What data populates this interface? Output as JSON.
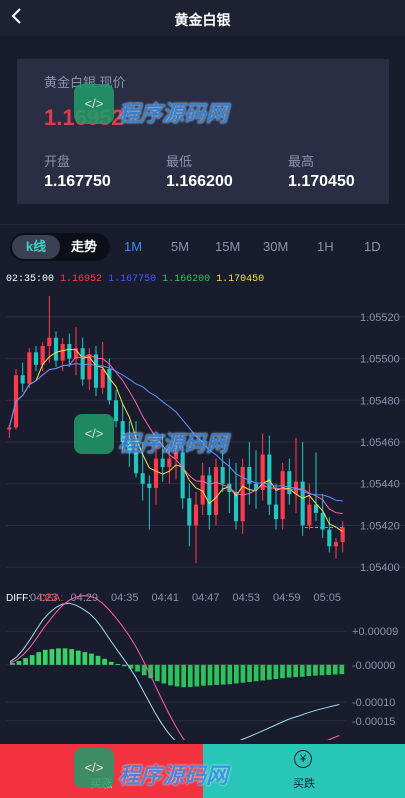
{
  "header": {
    "title": "黄金白银",
    "back_icon": "chevron-left-icon"
  },
  "card": {
    "label": "黄金白银 现价",
    "price": "1.16952",
    "open_label": "开盘",
    "open_value": "1.167750",
    "low_label": "最低",
    "low_value": "1.166200",
    "high_label": "最高",
    "high_value": "1.170450"
  },
  "tabs": {
    "kline": "k线",
    "trend": "走势",
    "timeframes": [
      "1M",
      "5M",
      "15M",
      "30M",
      "1H",
      "1D"
    ],
    "active": "1M"
  },
  "ohlc": {
    "time": "02:35:00",
    "close": "1.16952",
    "open": "1.167750",
    "low": "1.166200",
    "high": "1.170450"
  },
  "price_axis": [
    "1.05520",
    "1.05500",
    "1.05480",
    "1.05460",
    "1.05440",
    "1.05420",
    "1.05400"
  ],
  "time_axis": [
    "04:23",
    "04:29",
    "04:35",
    "04:41",
    "04:47",
    "04:53",
    "04:59",
    "05:05"
  ],
  "macd_axis": [
    "+0.00009",
    "-0.00000",
    "-0.00010",
    "-0.00015"
  ],
  "diff_label": "DIFF:",
  "dea_label": "DEA:",
  "bottom": {
    "buy_label": "买涨",
    "sell_label": "买跌",
    "sell_icon": "yen-circle-icon"
  },
  "watermark": {
    "text": "程序源码网"
  },
  "colors": {
    "up": "#ff3b4b",
    "down": "#22c6c0",
    "accent": "#3d8bff",
    "sell": "#27c6b6",
    "buy": "#f2323f"
  },
  "chart_data": {
    "type": "candlestick",
    "price_ticks": [
      1.0552,
      1.055,
      1.0548,
      1.0546,
      1.0544,
      1.0542,
      1.054
    ],
    "ylim": [
      1.0539,
      1.0553
    ],
    "time_ticks": [
      "04:23",
      "04:29",
      "04:35",
      "04:41",
      "04:47",
      "04:53",
      "04:59",
      "05:05"
    ],
    "candles": [
      [
        1.05466,
        1.05468,
        1.05462,
        1.05467
      ],
      [
        1.05467,
        1.05495,
        1.05466,
        1.05492
      ],
      [
        1.05492,
        1.05498,
        1.05484,
        1.05488
      ],
      [
        1.05488,
        1.05505,
        1.05486,
        1.05503
      ],
      [
        1.05503,
        1.05506,
        1.05494,
        1.05497
      ],
      [
        1.05497,
        1.05508,
        1.05494,
        1.05506
      ],
      [
        1.05506,
        1.0553,
        1.05498,
        1.0551
      ],
      [
        1.0551,
        1.05513,
        1.05496,
        1.05499
      ],
      [
        1.05499,
        1.0551,
        1.05494,
        1.05507
      ],
      [
        1.05507,
        1.05512,
        1.05496,
        1.055
      ],
      [
        1.055,
        1.05515,
        1.05492,
        1.05505
      ],
      [
        1.05505,
        1.0551,
        1.05487,
        1.0549
      ],
      [
        1.0549,
        1.05505,
        1.05485,
        1.05502
      ],
      [
        1.05502,
        1.05506,
        1.05482,
        1.05486
      ],
      [
        1.05486,
        1.05508,
        1.05483,
        1.05495
      ],
      [
        1.05495,
        1.055,
        1.05478,
        1.0548
      ],
      [
        1.0548,
        1.05485,
        1.05467,
        1.0547
      ],
      [
        1.0547,
        1.05478,
        1.05455,
        1.0546
      ],
      [
        1.0546,
        1.0547,
        1.05448,
        1.05455
      ],
      [
        1.05455,
        1.0547,
        1.05443,
        1.05445
      ],
      [
        1.05445,
        1.0546,
        1.05432,
        1.0544
      ],
      [
        1.0544,
        1.05444,
        1.05418,
        1.05438
      ],
      [
        1.05438,
        1.0546,
        1.0543,
        1.05452
      ],
      [
        1.05452,
        1.05464,
        1.05441,
        1.05448
      ],
      [
        1.05448,
        1.05458,
        1.0544,
        1.05452
      ],
      [
        1.05452,
        1.0546,
        1.05442,
        1.05455
      ],
      [
        1.05455,
        1.05458,
        1.05428,
        1.05433
      ],
      [
        1.05433,
        1.0544,
        1.0541,
        1.0542
      ],
      [
        1.0542,
        1.05436,
        1.05402,
        1.0543
      ],
      [
        1.0543,
        1.0545,
        1.05425,
        1.05444
      ],
      [
        1.05444,
        1.05448,
        1.05418,
        1.05425
      ],
      [
        1.05425,
        1.05452,
        1.0542,
        1.05448
      ],
      [
        1.05448,
        1.05456,
        1.05436,
        1.0544
      ],
      [
        1.0544,
        1.05452,
        1.05426,
        1.05436
      ],
      [
        1.05436,
        1.0545,
        1.05418,
        1.05422
      ],
      [
        1.05422,
        1.05452,
        1.05416,
        1.05448
      ],
      [
        1.05448,
        1.0546,
        1.0543,
        1.0544
      ],
      [
        1.0544,
        1.05456,
        1.05428,
        1.05437
      ],
      [
        1.05437,
        1.05464,
        1.05432,
        1.05454
      ],
      [
        1.05454,
        1.05463,
        1.05425,
        1.0543
      ],
      [
        1.0543,
        1.0544,
        1.05418,
        1.05423
      ],
      [
        1.05423,
        1.0545,
        1.05418,
        1.05446
      ],
      [
        1.05446,
        1.05452,
        1.0543,
        1.05435
      ],
      [
        1.05435,
        1.05462,
        1.05426,
        1.05441
      ],
      [
        1.05441,
        1.0546,
        1.05415,
        1.0542
      ],
      [
        1.0542,
        1.0544,
        1.05418,
        1.0543
      ],
      [
        1.0543,
        1.05455,
        1.05422,
        1.05426
      ],
      [
        1.05426,
        1.05435,
        1.05414,
        1.05418
      ],
      [
        1.05418,
        1.05424,
        1.05407,
        1.0541
      ],
      [
        1.0541,
        1.05414,
        1.05404,
        1.05412
      ],
      [
        1.05412,
        1.05422,
        1.05407,
        1.05419
      ]
    ],
    "macd_ticks": [
      9e-05,
      0,
      -0.0001,
      -0.00015
    ],
    "macd_ylim": [
      -0.00018,
      0.00012
    ],
    "macd_hist": [
      5e-06,
      1e-05,
      1.8e-05,
      2.6e-05,
      3.4e-05,
      4e-05,
      4.2e-05,
      4.4e-05,
      4.4e-05,
      4.2e-05,
      3.8e-05,
      3.4e-05,
      3e-05,
      2.4e-05,
      1.6e-05,
      8e-06,
      2e-06,
      -4e-06,
      -1e-05,
      -1.8e-05,
      -2.8e-05,
      -3.6e-05,
      -4.4e-05,
      -5e-05,
      -5.5e-05,
      -5.8e-05,
      -6e-05,
      -6e-05,
      -5.8e-05,
      -5.6e-05,
      -5.5e-05,
      -5.4e-05,
      -5.3e-05,
      -5.2e-05,
      -5e-05,
      -4.8e-05,
      -4.6e-05,
      -4.4e-05,
      -4.2e-05,
      -4e-05,
      -3.8e-05,
      -3.6e-05,
      -3.4e-05,
      -3.3e-05,
      -3.2e-05,
      -3e-05,
      -2.9e-05,
      -2.8e-05,
      -2.7e-05,
      -2.6e-05,
      -2.5e-05
    ]
  }
}
